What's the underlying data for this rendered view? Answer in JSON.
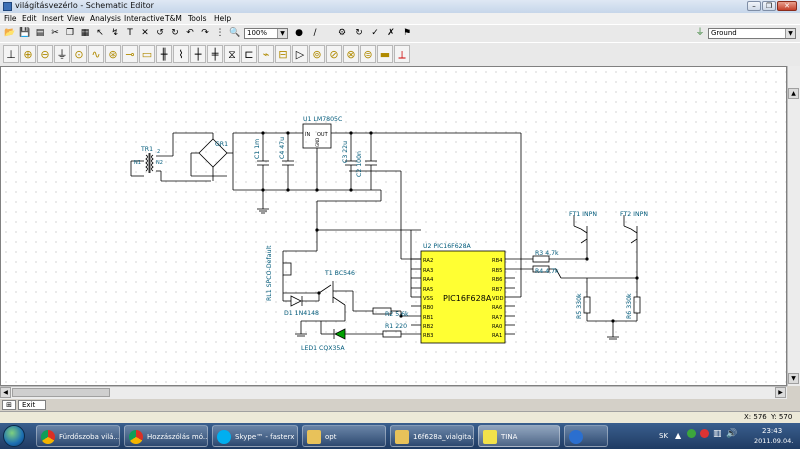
{
  "window": {
    "title": "világításvezérlo - Schematic Editor"
  },
  "menu": [
    "File",
    "Edit",
    "Insert",
    "View",
    "Analysis",
    "Interactive",
    "T&M",
    "Tools",
    "Help"
  ],
  "toolbar": {
    "zoom": "100%",
    "ground_select": "Ground"
  },
  "schematic": {
    "labels": {
      "u1": "U1 LM7805C",
      "u1_in": "IN",
      "u1_out": "OUT",
      "u1_gnd": "GND",
      "tr1": "TR1",
      "tr1_n1": "N1",
      "tr1_n2": "N2",
      "tr1_2": "2",
      "gr1": "GR1",
      "c1": "C1 1m",
      "c4": "C4 47u",
      "c3": "C3 22u",
      "c2": "C2 100n",
      "u2": "U2 PIC16F628A",
      "u2_body": "PIC16F628A",
      "rl1": "RL1 SPCO-Default",
      "d1": "D1 1N4148",
      "t1": "T1 BC546",
      "r2": "R2 5,6k",
      "r1": "R1 220",
      "led1": "LED1 CQX35A",
      "r3": "R3 4,7k",
      "r4": "R4 4,7k",
      "ft1": "FT1 INPN",
      "ft2": "FT2 INPN",
      "r5": "R5 330k",
      "r6": "R6 330k"
    },
    "pins_left": [
      "RA2",
      "RA3",
      "RA4",
      "RA5",
      "VSS",
      "RB0",
      "RB1",
      "RB2",
      "RB3"
    ],
    "pins_right": [
      "RB4",
      "RB5",
      "RB6",
      "RB7",
      "VDD",
      "RA6",
      "RA7",
      "RA0",
      "RA1"
    ]
  },
  "tabs": {
    "active": "Exit"
  },
  "status": {
    "x": "X: 576",
    "y": "Y: 570"
  },
  "taskbar": {
    "items": [
      "Fürdőszoba vilá...",
      "Hozzászólás mó...",
      "Skype™ - fasterx",
      "opt",
      "16f628a_vialgita...",
      "TINA",
      ""
    ],
    "lang": "SK",
    "time": "23:43",
    "date": "2011.09.04."
  }
}
